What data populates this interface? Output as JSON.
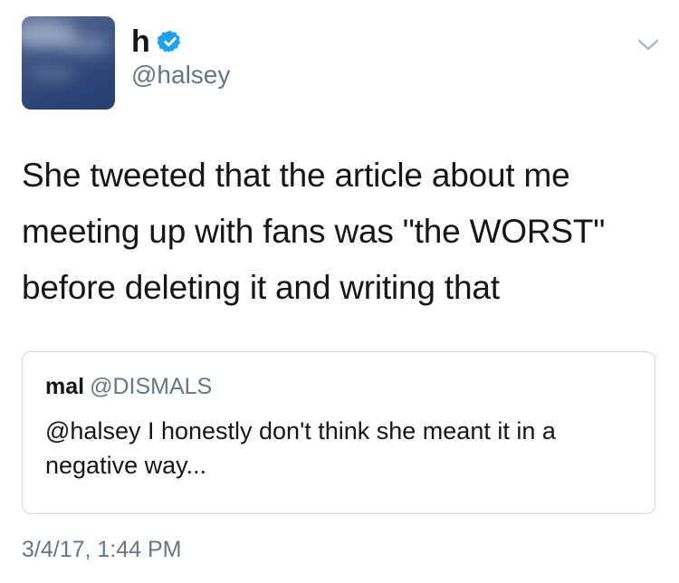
{
  "author": {
    "display_name": "h",
    "handle": "@halsey",
    "avatar_icon": "sky-avatar",
    "verified_icon": "verified-badge-icon"
  },
  "tweet": {
    "text": "She tweeted that the article about me meeting up with fans was \"the WORST\" before deleting it and writing that",
    "timestamp": "3/4/17, 1:44 PM"
  },
  "quoted_tweet": {
    "display_name": "mal",
    "handle": "@DISMALS",
    "text": "@halsey I honestly don't think she meant it in a negative way..."
  },
  "menu": {
    "icon": "chevron-down-icon"
  },
  "colors": {
    "text": "#14171a",
    "secondary_text": "#657786",
    "verified_blue": "#1da1f2",
    "border": "#d0d6db",
    "chevron": "#aab8c2"
  }
}
